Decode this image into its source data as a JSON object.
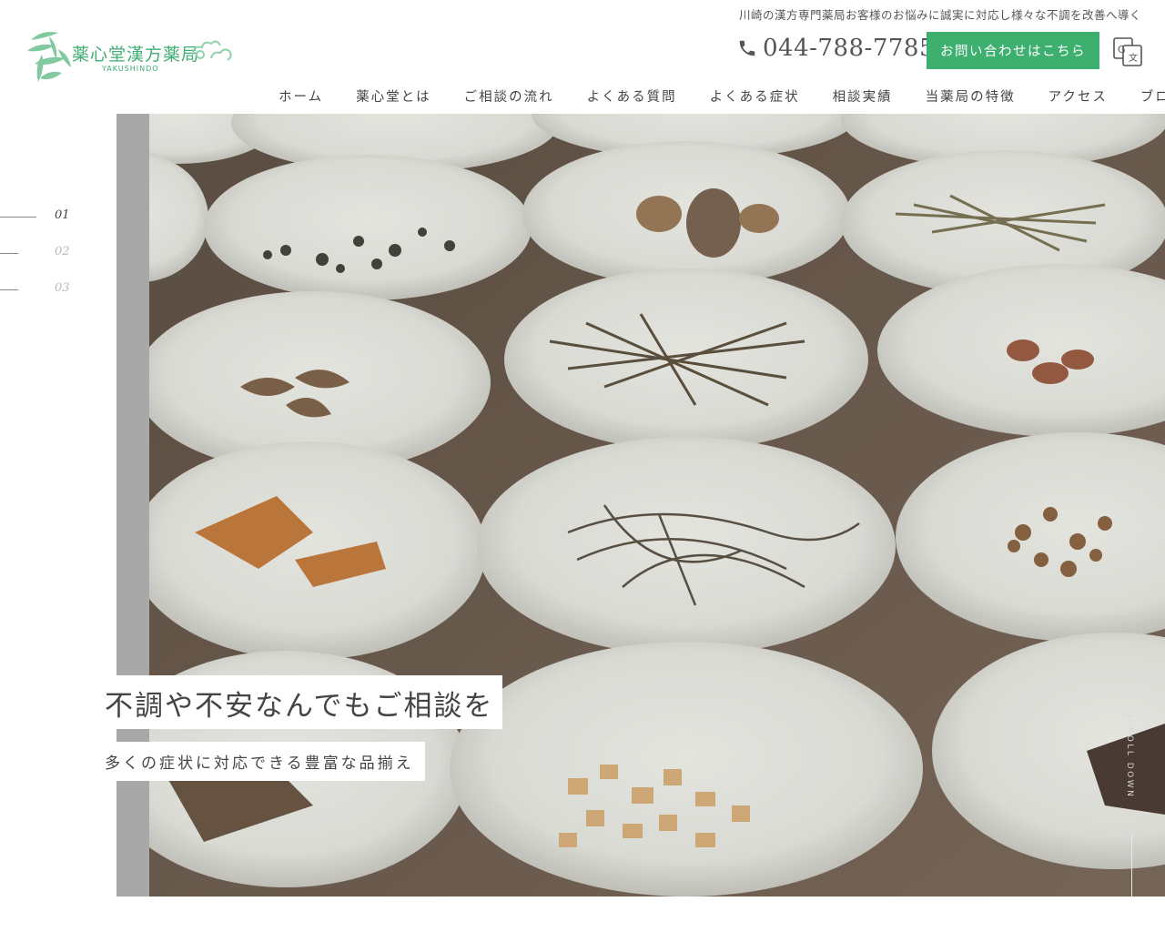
{
  "header": {
    "tagline": "川崎の漢方専門薬局お客様のお悩みに誠実に対応し様々な不調を改善へ導く",
    "logo_text": "薬心堂漢方薬局",
    "logo_sub": "YAKUSHINDO",
    "phone": "044-788-7785",
    "contact_label": "お問い合わせはこちら",
    "accent_color": "#3daf6f"
  },
  "nav": {
    "items": [
      {
        "label": "ホーム"
      },
      {
        "label": "薬心堂とは"
      },
      {
        "label": "ご相談の流れ"
      },
      {
        "label": "よくある質問"
      },
      {
        "label": "よくある症状"
      },
      {
        "label": "相談実績"
      },
      {
        "label": "当薬局の特徴"
      },
      {
        "label": "アクセス"
      },
      {
        "label": "ブログ"
      }
    ]
  },
  "hero": {
    "slides": [
      {
        "num": "01",
        "active": true
      },
      {
        "num": "02",
        "active": false
      },
      {
        "num": "03",
        "active": false
      }
    ],
    "headline": "不調や不安なんでもご相談を",
    "subline": "多くの症状に対応できる豊富な品揃え",
    "scroll_label": "SCROLL DOWN",
    "image_subject": "herb-dishes-photo"
  },
  "icons": {
    "phone": "phone-icon",
    "translate": "translate-icon",
    "logo_leaf": "bamboo-leaf-icon"
  }
}
